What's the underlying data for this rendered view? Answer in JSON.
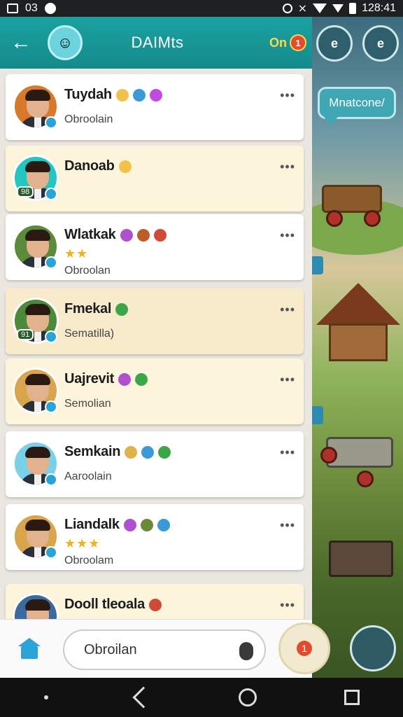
{
  "status_bar": {
    "left_text": "03",
    "time": "128:41"
  },
  "header": {
    "title": "DAIMts",
    "badge_text": "On",
    "badge_dot": "1"
  },
  "game_panel": {
    "speech_label": "Mnatcone/",
    "button1": "e",
    "button2": "e"
  },
  "contacts": [
    {
      "name": "Tuydah",
      "sub": "Obroolain",
      "style": "white",
      "ring": "#d97a2a",
      "emojis": [
        "#f2c14a",
        "#3a9ad8",
        "#c14ae0"
      ]
    },
    {
      "name": "Danoab",
      "sub": "",
      "style": "cream",
      "ring": "#23c7c1",
      "badge": "98",
      "emojis": [
        "#f2c14a"
      ]
    },
    {
      "name": "Wlatkak",
      "sub": "Obroolan",
      "style": "white",
      "ring": "#5a8a3a",
      "stars": "★★",
      "emojis": [
        "#b050d0",
        "#c05a2a",
        "#d04a3a"
      ]
    },
    {
      "name": "Fmekal",
      "sub": "Sematilla)",
      "style": "tan",
      "ring": "#4a8a3a",
      "badge": "91",
      "emojis": [
        "#3aa64a"
      ]
    },
    {
      "name": "Uajrevit",
      "sub": "Semolian",
      "style": "cream",
      "ring": "#d8a54a",
      "emojis": [
        "#b050d0",
        "#3aa64a"
      ]
    },
    {
      "name": "Semkain",
      "sub": "Aaroolain",
      "style": "white",
      "ring": "#7ad0e8",
      "emojis": [
        "#e0b24a",
        "#3a9ad8",
        "#3aa64a"
      ]
    },
    {
      "name": "Liandalk",
      "sub": "Obroolam",
      "style": "white",
      "ring": "#d8a54a",
      "stars": "★★★",
      "emojis": [
        "#b050d0",
        "#6a8a3a",
        "#3a9ad8"
      ]
    },
    {
      "name": "Dooll tleoala",
      "sub": "",
      "style": "cream",
      "ring": "#3a6aa0",
      "emojis": [
        "#d04a3a"
      ]
    }
  ],
  "input": {
    "value": "Obroilan"
  },
  "send_badge": "1"
}
